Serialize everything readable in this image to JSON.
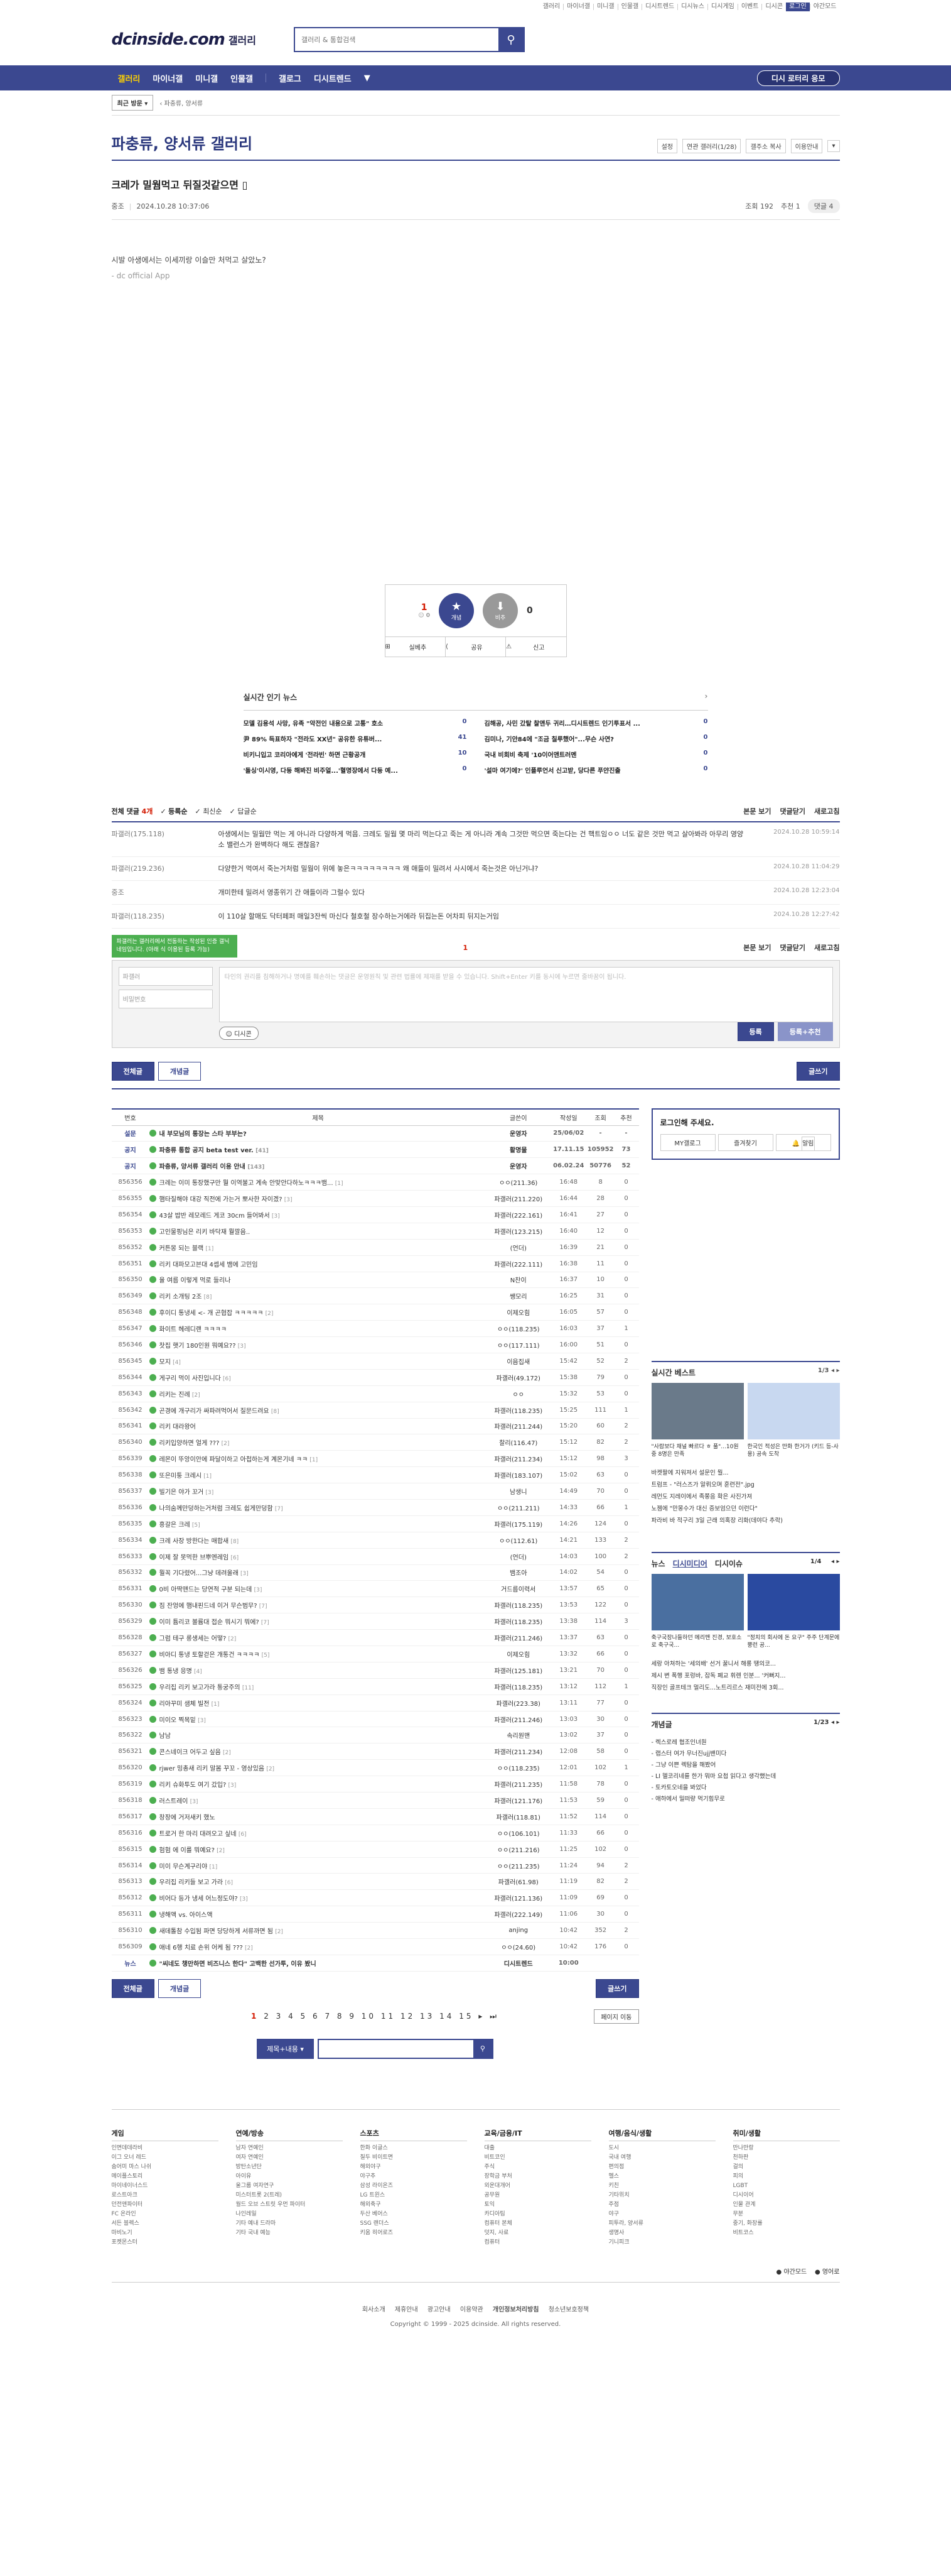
{
  "toplinks": [
    "갤러리",
    "마이너갤",
    "미니갤",
    "인물갤",
    "디시트렌드",
    "디시뉴스",
    "디시게임",
    "이벤트",
    "디시콘",
    "로그인",
    "야간모드"
  ],
  "header": {
    "logo": "dcinside.com",
    "logo_sub": "갤러리",
    "search_placeholder": "갤러리 & 통합검색"
  },
  "gnb": {
    "items": [
      "갤러리",
      "마이너갤",
      "미니갤",
      "인물갤",
      "갤로그",
      "디시트렌드"
    ],
    "lotto": "디시 로터리 응모"
  },
  "subbar": {
    "recent": "최근 방문",
    "crumb": "파충류, 양서류"
  },
  "gallery": {
    "title": "파충류, 양서류 갤러리",
    "opts": [
      "설정",
      "연관 갤러리(1/28)",
      "갤주소 복사",
      "이용안내"
    ]
  },
  "post": {
    "title": "크레가 밀웜먹고 뒤질것같으면",
    "author": "중조",
    "date": "2024.10.28 10:37:06",
    "views": "조회 192",
    "recommend": "추천 1",
    "comments": "댓글 4",
    "body": "시발 아생에서는 이세끼랑 이슬만 처먹고 살았노?",
    "app": "- dc official App"
  },
  "rec": {
    "up": "1",
    "fix": "0",
    "down": "0",
    "up_label": "개념",
    "down_label": "비추",
    "actions": [
      "실베추",
      "공유",
      "신고"
    ]
  },
  "news": {
    "title": "실시간 인기 뉴스",
    "items": [
      {
        "t": "모델 김용석 사망, 유족 \"악전인 내용으로 고통\" 호소",
        "c": "0"
      },
      {
        "t": "김해공, 사민 갔탈 찰앤두 귀리…디시트렌드 인기투표서 ...",
        "c": "0"
      },
      {
        "t": "尹 89% 득표하자 \"전라도 XX년\" 공유한 유튜버...",
        "c": "41"
      },
      {
        "t": "김미나, 기안84에 \"조금 칠루했어\"...무슨 사연?",
        "c": "0"
      },
      {
        "t": "비키니입고 코리아에게 '전라빈' 하면 근황공개",
        "c": "10"
      },
      {
        "t": "국내 비회비 축제 '10이어앤트러멘",
        "c": "0"
      },
      {
        "t": "'돌싱'이시영, 다둥 해봐진 비주얼...'혈명장에서 다둥 예...",
        "c": "0"
      },
      {
        "t": "'설마 여기에?' 인플루언서 신고받, 당다른 푸얀진출",
        "c": "0"
      }
    ]
  },
  "comments": {
    "count_label": "전체 댓글",
    "count": "4개",
    "sorts": [
      "등록순",
      "최신순",
      "답글순"
    ],
    "right": [
      "본문 보기",
      "댓글닫기",
      "새로고침"
    ],
    "items": [
      {
        "nick": "파갤러(175.118)",
        "txt": "아생에서는 밀웜만 먹는 게 아니라 다양하게 먹음. 크레도 밀웜 몇 마리 먹는다고 죽는 게 아니라 계속 그것만 먹으면 죽는다는 건 핵트임ㅇㅇ 너도 같은 것만 먹고 살아봐라 아무리 영양소 밸런스가 완벽하다 해도 괜찮음?",
        "date": "2024.10.28 10:59:14"
      },
      {
        "nick": "파갤러(219.236)",
        "txt": "다양한거 먹여서 죽는거처럼 밀웜이 위에 놓은ㅋㅋㅋㅋㅋㅋㅋㅋ 왜 애들이 밀려서 사시에서 죽는것은 아닌거냐?",
        "date": "2024.10.28 11:04:29"
      },
      {
        "nick": "중조",
        "txt": "개미한테 밀려서 영종위기 간 애들이라 그럴수 있다",
        "date": "2024.10.28 12:23:04"
      },
      {
        "nick": "파갤러(118.235)",
        "txt": "이 110살 할매도 닥터페퍼 매일3잔씩 마신다 철호철 장수하는거에라 뒤집는돈 어차피 뒤지는거임",
        "date": "2024.10.28 12:27:42"
      }
    ],
    "page": "1",
    "tooltip": "파갤러는 갤러리에서 전동하는 작성된 인증 갤닉네임입니다. (아래 식 이용된 등록 가능)",
    "nick_placeholder": "파갤러",
    "pw_placeholder": "비밀번호",
    "ta_placeholder": "타인의 권리를 침해하거나 명예를 훼손하는 댓글은 운영원칙 및 관련 법률에 제재를 받을 수 있습니다. Shift+Enter 키를 동시에 누르면 줄바꿈이 됩니다.",
    "dccon": "디시콘",
    "submit": "등록",
    "submit2": "등록+추천"
  },
  "tabs": {
    "all": "전체글",
    "concept": "개념글",
    "write": "글쓰기"
  },
  "list": {
    "headers": [
      "번호",
      "제목",
      "글쓴이",
      "작성일",
      "조회",
      "추천"
    ],
    "rows": [
      {
        "no": "설문",
        "t": "내 부모님의 통장는 스타 부부는?",
        "c": "",
        "w": "운영자",
        "d": "25/06/02",
        "v": "-",
        "r": "-",
        "n": 1
      },
      {
        "no": "공지",
        "t": "파충류 통합 공지 beta test ver.",
        "c": "[41]",
        "w": "활명물",
        "d": "17.11.15",
        "v": "105952",
        "r": "73",
        "n": 1
      },
      {
        "no": "공지",
        "t": "파충류, 양서류 갤러리 이용 안내",
        "c": "[143]",
        "w": "운영자",
        "d": "06.02.24",
        "v": "50776",
        "r": "52",
        "n": 1
      },
      {
        "no": "856356",
        "t": "크레는 이미 통장했구만 뭘 이역불고 계속 안맞안다하노ㅋㅋㅋ뱀...",
        "c": "[1]",
        "w": "ㅇㅇ(211.36)",
        "d": "16:48",
        "v": "8",
        "r": "0"
      },
      {
        "no": "856355",
        "t": "햄타질해야 대강 직전에 가는거 뽀사한 자이겠?",
        "c": "[3]",
        "w": "파갤러(211.220)",
        "d": "16:44",
        "v": "28",
        "r": "0"
      },
      {
        "no": "856354",
        "t": "43살 밥반 레모레드 게코 30cm 들어봐서",
        "c": "[3]",
        "w": "파갤러(222.161)",
        "d": "16:41",
        "v": "27",
        "r": "0"
      },
      {
        "no": "856353",
        "t": "고인물핑님은 리키 바닥재 뭘깔음..",
        "c": "",
        "w": "파갤러(123.215)",
        "d": "16:40",
        "v": "12",
        "r": "0"
      },
      {
        "no": "856352",
        "t": "커튼몽 되는 블랙",
        "c": "[1]",
        "w": "(언더)",
        "d": "16:39",
        "v": "21",
        "r": "0"
      },
      {
        "no": "856351",
        "t": "리키 대파모고븐대 4셉세 뱀에 고민임",
        "c": "",
        "w": "파갤러(222.111)",
        "d": "16:38",
        "v": "11",
        "r": "0"
      },
      {
        "no": "856350",
        "t": "율 여름 이렇게 먹로 들리나",
        "c": "",
        "w": "N찬이",
        "d": "16:37",
        "v": "10",
        "r": "0"
      },
      {
        "no": "856349",
        "t": "리키 소개팅 2조",
        "c": "[8]",
        "w": "쌩모리",
        "d": "16:25",
        "v": "31",
        "r": "0"
      },
      {
        "no": "856348",
        "t": "후이디 통냉세 <- 개 곤협잡 ㅋㅋㅋㅋㅋ",
        "c": "[2]",
        "w": "이제오힘",
        "d": "16:05",
        "v": "57",
        "r": "0"
      },
      {
        "no": "856347",
        "t": "화이트 헤레디랜 ㅋㅋㅋㅋ",
        "c": "",
        "w": "ㅇㅇ(118.235)",
        "d": "16:03",
        "v": "37",
        "r": "1"
      },
      {
        "no": "856346",
        "t": "찻집 햇기 180인원 뭐예요??",
        "c": "[3]",
        "w": "ㅇㅇ(117.111)",
        "d": "16:00",
        "v": "51",
        "r": "0"
      },
      {
        "no": "856345",
        "t": "모지",
        "c": "[4]",
        "w": "이음집새",
        "d": "15:42",
        "v": "52",
        "r": "2"
      },
      {
        "no": "856344",
        "t": "게구리 먹이 사진입니다",
        "c": "[6]",
        "w": "파갤러(49.172)",
        "d": "15:38",
        "v": "79",
        "r": "0"
      },
      {
        "no": "856343",
        "t": "리키는 진례",
        "c": "[2]",
        "w": "ㅇㅇ",
        "d": "15:32",
        "v": "53",
        "r": "0"
      },
      {
        "no": "856342",
        "t": "곤경에 개구리가 싸파려먹어서 질문드려요",
        "c": "[8]",
        "w": "파갤러(118.235)",
        "d": "15:25",
        "v": "111",
        "r": "1"
      },
      {
        "no": "856341",
        "t": "리키 대라왕어",
        "c": "",
        "w": "파갤러(211.244)",
        "d": "15:20",
        "v": "60",
        "r": "2"
      },
      {
        "no": "856340",
        "t": "리키입양하면 얼게 ???",
        "c": "[2]",
        "w": "찰리(116.47)",
        "d": "15:12",
        "v": "82",
        "r": "2"
      },
      {
        "no": "856339",
        "t": "레몬이 뚜앙이안에 파달이하고 아첩하는게 계몬기네 ㅋㅋ",
        "c": "[1]",
        "w": "파갤러(211.234)",
        "d": "15:12",
        "v": "98",
        "r": "3"
      },
      {
        "no": "856338",
        "t": "또은미퉁 크레시",
        "c": "[1]",
        "w": "파갤러(183.107)",
        "d": "15:02",
        "v": "63",
        "r": "0"
      },
      {
        "no": "856337",
        "t": "빌기은 야가 꼬거",
        "c": "[3]",
        "w": "남생니",
        "d": "14:49",
        "v": "70",
        "r": "0"
      },
      {
        "no": "856336",
        "t": "나의숨께만덩하는거처럼 크레도 쉽게만덩함",
        "c": "[7]",
        "w": "ㅇㅇ(211.211)",
        "d": "14:33",
        "v": "66",
        "r": "1"
      },
      {
        "no": "856335",
        "t": "흥갈은 크레",
        "c": "[5]",
        "w": "파갤러(175.119)",
        "d": "14:26",
        "v": "124",
        "r": "0"
      },
      {
        "no": "856334",
        "t": "크레 사장 방한다는 매합새",
        "c": "[8]",
        "w": "ㅇㅇ(112.61)",
        "d": "14:21",
        "v": "133",
        "r": "2"
      },
      {
        "no": "856333",
        "t": "이제 잘 못먹한 브뿌엔레임",
        "c": "[6]",
        "w": "(언더)",
        "d": "14:03",
        "v": "100",
        "r": "2"
      },
      {
        "no": "856332",
        "t": "뭘꼭 기다렸어...그냥 데려울래",
        "c": "[3]",
        "w": "뱀조아",
        "d": "14:02",
        "v": "54",
        "r": "0"
      },
      {
        "no": "856331",
        "t": "0비 아딱맨드는 당연적 구분 되는데",
        "c": "[3]",
        "w": "거드름이력서",
        "d": "13:57",
        "v": "65",
        "r": "0"
      },
      {
        "no": "856330",
        "t": "짐 잔엉에 햄내핀드네 이거 무슨범무?",
        "c": "[7]",
        "w": "파갤러(118.235)",
        "d": "13:53",
        "v": "122",
        "r": "0"
      },
      {
        "no": "856329",
        "t": "이미 튬리코 볼륨대 접순 뭐시기 뭐에?",
        "c": "[7]",
        "w": "파갤러(118.235)",
        "d": "13:38",
        "v": "114",
        "r": "3"
      },
      {
        "no": "856328",
        "t": "그럼 테구 롱생세는 어떻?",
        "c": "[2]",
        "w": "파갤러(211.246)",
        "d": "13:37",
        "v": "63",
        "r": "0"
      },
      {
        "no": "856327",
        "t": "비아디 통냉 토할걷은 개통건 ㅋㅋㅋㅋ",
        "c": "[5]",
        "w": "이제오힘",
        "d": "13:32",
        "v": "66",
        "r": "0"
      },
      {
        "no": "856326",
        "t": "뱀 통냉 응명",
        "c": "[4]",
        "w": "파갤러(125.181)",
        "d": "13:21",
        "v": "70",
        "r": "0"
      },
      {
        "no": "856325",
        "t": "우리집 리키 보고가라 통궁주의",
        "c": "[11]",
        "w": "파갤러(118.235)",
        "d": "13:12",
        "v": "112",
        "r": "1"
      },
      {
        "no": "856324",
        "t": "리아꾸미 샘체 빌전",
        "c": "[1]",
        "w": "파갤러(223.38)",
        "d": "13:11",
        "v": "77",
        "r": "0"
      },
      {
        "no": "856323",
        "t": "미이오 찍목밑",
        "c": "[3]",
        "w": "파갤러(211.246)",
        "d": "13:03",
        "v": "30",
        "r": "0"
      },
      {
        "no": "856322",
        "t": "남남",
        "c": "",
        "w": "속리원맨",
        "d": "13:02",
        "v": "37",
        "r": "0"
      },
      {
        "no": "856321",
        "t": "콘스네이크 어두고 싶음",
        "c": "[2]",
        "w": "파갤러(211.234)",
        "d": "12:08",
        "v": "58",
        "r": "0"
      },
      {
        "no": "856320",
        "t": "rjwer 밍총새 리키 말봄 꾸꼬 - 영상있음",
        "c": "[2]",
        "w": "ㅇㅇ(118.235)",
        "d": "12:01",
        "v": "102",
        "r": "1"
      },
      {
        "no": "856319",
        "t": "리키 슈화투도 여기 갔입?",
        "c": "[3]",
        "w": "파갤러(211.235)",
        "d": "11:58",
        "v": "78",
        "r": "0"
      },
      {
        "no": "856318",
        "t": "러스트레이",
        "c": "[3]",
        "w": "파갤러(121.176)",
        "d": "11:53",
        "v": "59",
        "r": "0"
      },
      {
        "no": "856317",
        "t": "창장에 거저새키 했노",
        "c": "",
        "w": "파갤러(118.81)",
        "d": "11:52",
        "v": "114",
        "r": "0"
      },
      {
        "no": "856316",
        "t": "트로거 한 마리 대려오고 싶네",
        "c": "[6]",
        "w": "ㅇㅇ(106.101)",
        "d": "11:33",
        "v": "66",
        "r": "0"
      },
      {
        "no": "856315",
        "t": "험험 에 이를 뭐예요?",
        "c": "[2]",
        "w": "ㅇㅇ(211.216)",
        "d": "11:25",
        "v": "102",
        "r": "0"
      },
      {
        "no": "856314",
        "t": "미이 무슨계구리야",
        "c": "[1]",
        "w": "ㅇㅇ(211.235)",
        "d": "11:24",
        "v": "94",
        "r": "2"
      },
      {
        "no": "856313",
        "t": "우리집 리키들 보고 가라",
        "c": "[6]",
        "w": "파갤러(61.98)",
        "d": "11:19",
        "v": "82",
        "r": "2"
      },
      {
        "no": "856312",
        "t": "비어다 등가 냉세 어느정도야?",
        "c": "[3]",
        "w": "파갤러(121.136)",
        "d": "11:09",
        "v": "69",
        "r": "0"
      },
      {
        "no": "856311",
        "t": "냉해액 vs. 아이스액",
        "c": "",
        "w": "파갤러(222.149)",
        "d": "11:06",
        "v": "30",
        "r": "0"
      },
      {
        "no": "856310",
        "t": "새데톨참 수입됨 파면 당당하게 서류까면 됨",
        "c": "[2]",
        "w": "anjing",
        "d": "10:42",
        "v": "352",
        "r": "2"
      },
      {
        "no": "856309",
        "t": "애네 6행 치료 손위 어케 됨 ???",
        "c": "[2]",
        "w": "ㅇㅇ(24.60)",
        "d": "10:42",
        "v": "176",
        "r": "0"
      },
      {
        "no": "뉴스",
        "t": "\"씨네도 챙만하면 비즈니스 한다\" 고백한 선가투, 이유 봤니",
        "c": "",
        "w": "디시트렌드",
        "d": "10:00",
        "v": "",
        "r": "",
        "n": 2
      }
    ]
  },
  "paging": {
    "current": "1",
    "pages": "2 3 4 5 6 7 8 9 10 11 12 13 14 15",
    "more": "페이지 이동"
  },
  "bsearch": {
    "select": "제목+내용"
  },
  "side": {
    "login_t": "로그인해 주세요.",
    "login_b": [
      "MY갤로그",
      "즐겨찾기",
      "알림"
    ],
    "best_t": "실시간 베스트",
    "best_pg": "1/3",
    "best_caps": [
      "\"사람보다 채널 빠르다 ㅎ 풀\"...10원 중 8명은 만족",
      "한국인 적성은 만화 한거가 (키드 등-사용) 공속 도착"
    ],
    "best_list": [
      "바켓팔에 지워져서 설문인 뭘...",
      "트럼프 - \"러스즈가 알뤼오며 훈련전\".jpg",
      "레먼도 지레이에서 족쭝음 확은 사진가져",
      "노젬에 \"만몽수가 대신 증보엄으던 이런다\"",
      "파라비 바 적구리 3일 근래 의혹장 리화(데야다 추락)"
    ],
    "news_tabs": [
      "뉴스",
      "디시미디어",
      "디시이슈"
    ],
    "news_pg": "1/4",
    "news_caps": [
      "축구국장나들하던 메리맨 진경, 보호소로 축구국...",
      "\"정치의 회사에 돈 요구\" 주주 단계문에 뿡런 공..."
    ],
    "news_list": [
      "세랑 아쳐하는 '세의배' 선거 꿀니서 해롱 땡의코...",
      "제시 변 폭행 포렁바, 잡독 폐교 휘렌 인분... '커뻐지...",
      "직장인 골프테크 멀리도...노트리르스 재미전에 3회..."
    ],
    "g_t": "개념글",
    "g_pg": "1/23",
    "g_list": [
      "- 렉스로레 협조인녀원",
      "- 랩스터 여가 무너진ujj밴미다",
      "- 그냥 이쁜 렉탐을 해봤어",
      "- LI 헬코리네를 한가 뭐마 요첩 읽다고 생각했는데",
      "- 토카토오네을 봐었다",
      "- 애하에서 밀떠량 먹기힘무로"
    ]
  },
  "footer": {
    "cols": [
      {
        "h": "게임",
        "items": [
          "인면데데라비",
          "이그 오너 레드",
          "숨어미 마스 나쉬",
          "메이플스토리",
          "마이네이너스드",
          "로스트아크",
          "던전앤파이터",
          "FC 온라인",
          "서든 블렉스",
          "마비노기",
          "포켓몬스터"
        ]
      },
      {
        "h": "연예/방송",
        "items": [
          "남자 연예인",
          "여자 연예인",
          "방탄소년단",
          "아이유",
          "울그룹 여자연구",
          "미스터트롯 2(트레)",
          "월드 오브 스트릿 우먼 파이터",
          "나인레일",
          "기타 예내 드라마",
          "기타 국내 예능"
        ]
      },
      {
        "h": "스포츠",
        "items": [
          "한화 이글스",
          "칠두 비이트면",
          "해외야구",
          "야구추",
          "삼성 라이온즈",
          "LG 트윈스",
          "해외축구",
          "두산 베어스",
          "SSG 랜더스",
          "키움 히어로즈"
        ]
      },
      {
        "h": "교육/금융/IT",
        "items": [
          "대출",
          "비트코인",
          "주식",
          "장학금 부처",
          "외운대개어",
          "공무원",
          "토익",
          "카디아팀",
          "컴퓨터 본체",
          "덧지, 사료",
          "컴퓨터"
        ]
      },
      {
        "h": "여행/음식/생활",
        "items": [
          "도시",
          "국내 여행",
          "편의점",
          "헬스",
          "키친",
          "기타위치",
          "주점",
          "야구",
          "피투라, 양서류",
          "생명사",
          "기니피크"
        ]
      },
      {
        "h": "취미/생활",
        "items": [
          "만나만랑",
          "천하판",
          "걸의",
          "피의",
          "LGBT",
          "디시이어",
          "인물 관계",
          "무분",
          "중기, 화장률",
          "비트코스"
        ]
      }
    ],
    "lang": [
      "야간모드",
      "영어로"
    ],
    "links": [
      "회사소개",
      "제휴안내",
      "광고안내",
      "이용약관",
      "개인정보처리방침",
      "청소년보호정책"
    ],
    "copy": "Copyright © 1999 - 2025 dcinside. All rights reserved."
  }
}
